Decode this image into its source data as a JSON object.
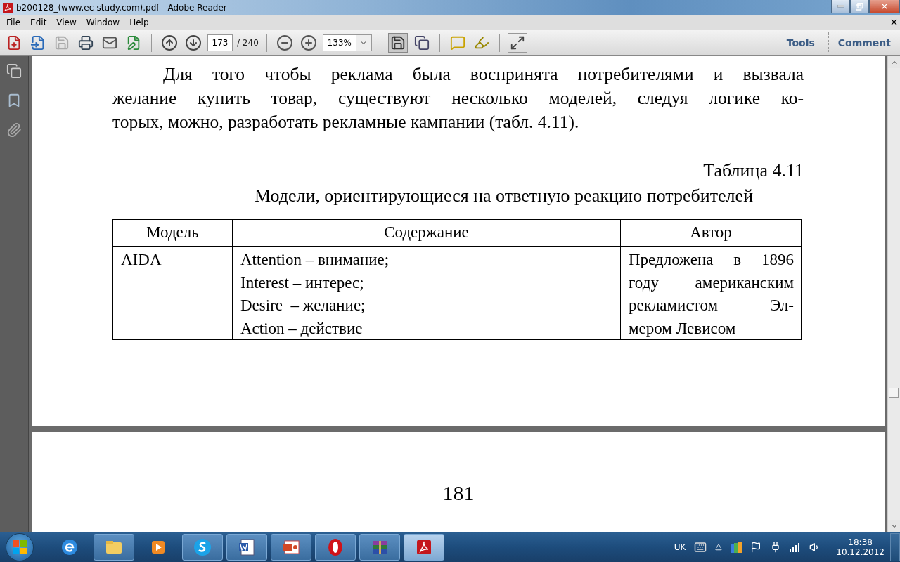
{
  "window": {
    "title": "b200128_(www.ec-study.com).pdf - Adobe Reader"
  },
  "menu": [
    "File",
    "Edit",
    "View",
    "Window",
    "Help"
  ],
  "toolbar": {
    "page_current": "173",
    "page_total": "/ 240",
    "zoom": "133%",
    "links": [
      "Tools",
      "Comment"
    ]
  },
  "page": {
    "paragraph_lines": [
      "Для того чтобы реклама была воспринята потребителями и вызвала",
      "желание купить товар, существуют несколько моделей, следуя логике ко-",
      "торых, можно, разработать рекламные кампании (табл. 4.11)."
    ],
    "table_caption": "Таблица 4.11",
    "table_title": "Модели, ориентирующиеся на ответную реакцию потребителей",
    "columns": [
      "Модель",
      "Содержание",
      "Автор"
    ],
    "rows": [
      {
        "model": "AIDA",
        "content_lines": [
          "Attention – внимание;",
          "Interest – интерес;",
          "Desire  – желание;",
          "Action – действие"
        ],
        "author_lines": [
          "Предложена в 1896",
          "году американским",
          "рекламистом Эл-",
          "мером Левисом"
        ]
      }
    ]
  },
  "next_page": {
    "page_number": "181"
  },
  "taskbar": {
    "apps": [
      {
        "kind": "ie",
        "running": false,
        "selected": false
      },
      {
        "kind": "explorer",
        "running": true,
        "selected": false
      },
      {
        "kind": "media",
        "running": false,
        "selected": false
      },
      {
        "kind": "skype",
        "running": true,
        "selected": false
      },
      {
        "kind": "word",
        "running": true,
        "selected": false
      },
      {
        "kind": "powerpoint",
        "running": true,
        "selected": false
      },
      {
        "kind": "opera",
        "running": true,
        "selected": false
      },
      {
        "kind": "winrar",
        "running": true,
        "selected": false
      },
      {
        "kind": "reader",
        "running": true,
        "selected": true
      }
    ]
  },
  "tray": {
    "language": "UK",
    "time": "18:38",
    "date": "10.12.2012"
  }
}
